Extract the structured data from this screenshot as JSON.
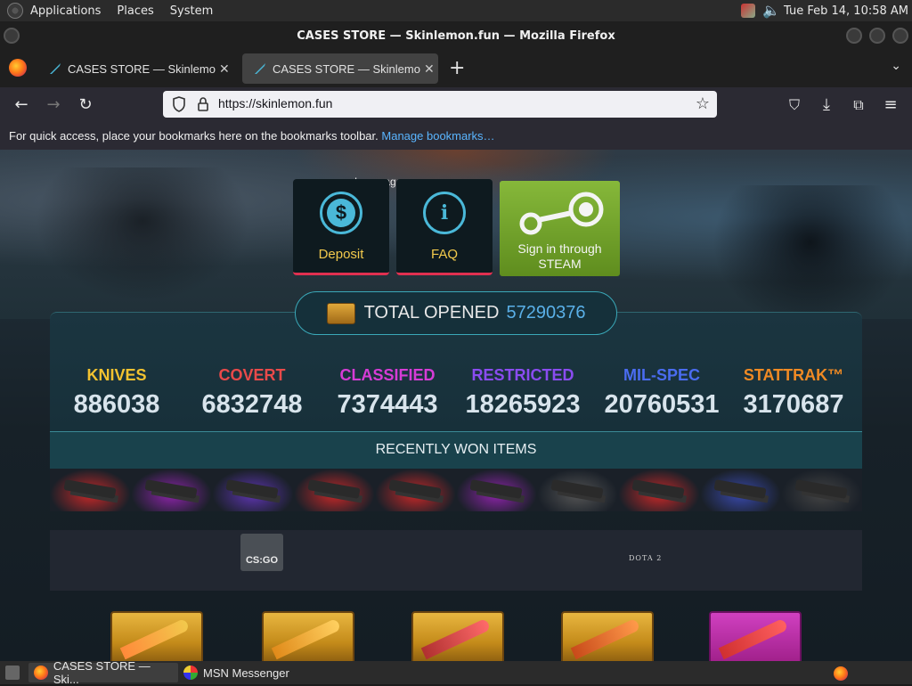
{
  "panel": {
    "menus": [
      "Applications",
      "Places",
      "System"
    ],
    "clock": "Tue Feb 14, 10:58 AM"
  },
  "window": {
    "title": "CASES STORE — Skinlemon.fun — Mozilla Firefox"
  },
  "tabs": [
    {
      "title": "CASES STORE — Skinlemon"
    },
    {
      "title": "CASES STORE — Skinlemon"
    }
  ],
  "urlbar": {
    "url": "https://skinlemon.fun"
  },
  "bookmarks": {
    "message": "For quick access, place your bookmarks here on the bookmarks toolbar.",
    "link": "Manage bookmarks…"
  },
  "page": {
    "language_label": "Language",
    "deposit_label": "Deposit",
    "faq_label": "FAQ",
    "steam_label_line1": "Sign in through",
    "steam_label_line2": "STEAM",
    "total_label": "TOTAL OPENED",
    "total_value": "57290376",
    "stats": [
      {
        "category": "KNIVES",
        "value": "886038",
        "color": "#f2c230"
      },
      {
        "category": "COVERT",
        "value": "6832748",
        "color": "#e84a4a"
      },
      {
        "category": "CLASSIFIED",
        "value": "7374443",
        "color": "#d63cd6"
      },
      {
        "category": "RESTRICTED",
        "value": "18265923",
        "color": "#8a4cf0"
      },
      {
        "category": "MIL-SPEC",
        "value": "20760531",
        "color": "#4a6cf0"
      },
      {
        "category": "STATTRAK™",
        "value": "3170687",
        "color": "#f08a24"
      }
    ],
    "recent_header": "RECENTLY WON ITEMS",
    "recent_item_glows": [
      "#c62828",
      "#8e24aa",
      "#5e35b1",
      "#c62828",
      "#c62828",
      "#8e24aa",
      "#555555",
      "#c62828",
      "#3949ab",
      "#444444"
    ],
    "games": [
      "CS:GO",
      "DOTA 2"
    ]
  },
  "taskbar": {
    "items": [
      "CASES STORE — Ski...",
      "MSN Messenger"
    ]
  }
}
